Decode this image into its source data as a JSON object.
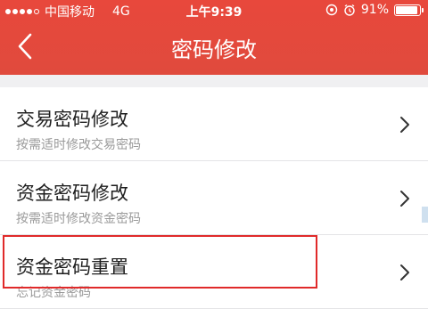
{
  "status_bar": {
    "carrier": "中国移动",
    "network": "4G",
    "time": "上午9:39",
    "battery_percent": "91%",
    "battery_level": 0.91,
    "signal_bars": 4,
    "signal_total": 5
  },
  "nav": {
    "title": "密码修改",
    "back_icon": "chevron-left-icon"
  },
  "items": [
    {
      "title": "交易密码修改",
      "subtitle": "按需适时修改交易密码"
    },
    {
      "title": "资金密码修改",
      "subtitle": "按需适时修改资金密码"
    },
    {
      "title": "资金密码重置",
      "subtitle": "忘记资金密码"
    }
  ],
  "colors": {
    "header": "#e04a3d",
    "highlight_border": "#e02a2a"
  }
}
